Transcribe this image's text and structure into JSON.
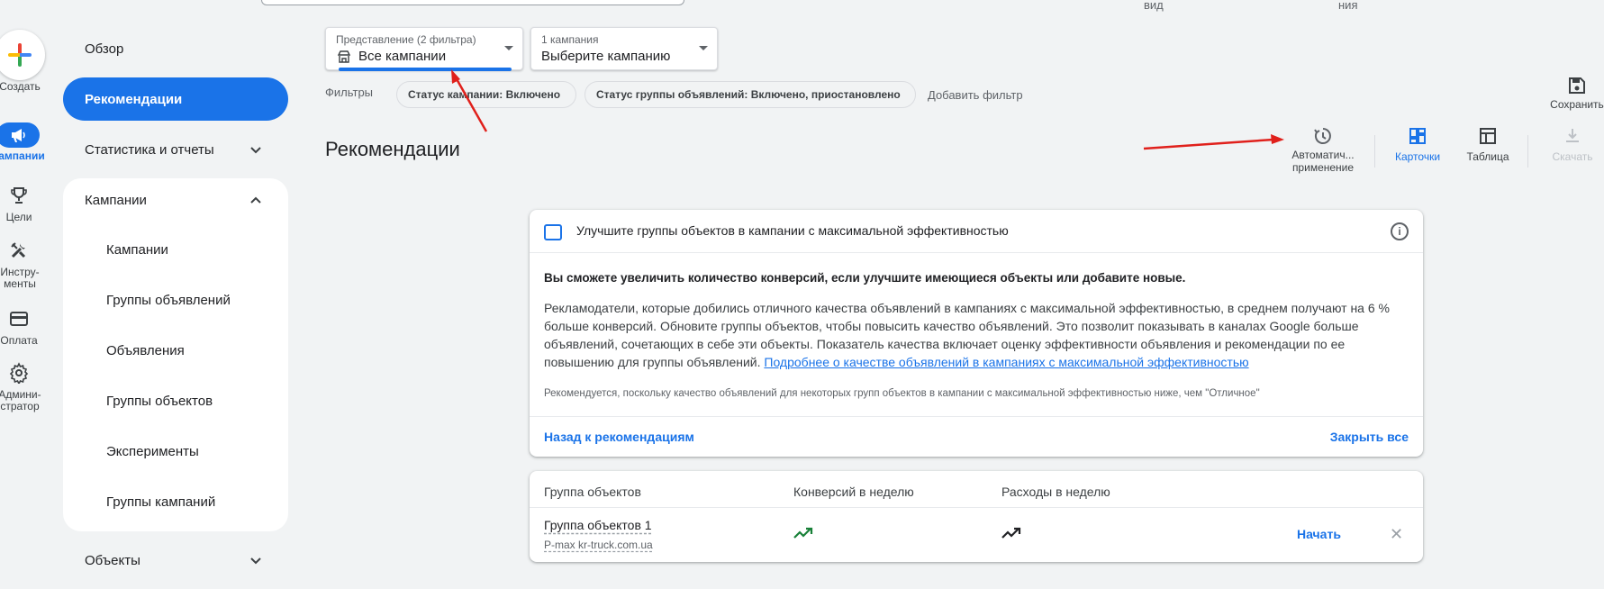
{
  "top": {
    "frag_left": "вид",
    "frag_right": "ния"
  },
  "rail": {
    "create_label": "Создать",
    "campaigns_label": "ампании",
    "goals_label": "Цели",
    "tools_label": "Инстру-\nменты",
    "billing_label": "Оплата",
    "admin_label": "Админи-\nстратор"
  },
  "nav": {
    "overview": "Обзор",
    "recommendations": "Рекомендации",
    "stats": "Статистика и отчеты",
    "campaigns_group": "Кампании",
    "sub_items": [
      "Кампании",
      "Группы объявлений",
      "Объявления",
      "Группы объектов",
      "Эксперименты",
      "Группы кампаний"
    ],
    "objects": "Объекты"
  },
  "view_selector": {
    "caption": "Представление (2 фильтра)",
    "value": "Все кампании"
  },
  "campaign_selector": {
    "caption": "1 кампания",
    "value": "Выберите кампанию"
  },
  "filters": {
    "label": "Фильтры",
    "chips": [
      "Статус кампании: Включено",
      "Статус группы объявлений: Включено, приостановлено"
    ],
    "add": "Добавить фильтр"
  },
  "save_label": "Сохранить",
  "page_title": "Рекомендации",
  "toolbar": {
    "auto_apply": "Автоматич...\nприменение",
    "cards": "Карточки",
    "table": "Таблица",
    "download": "Скачать"
  },
  "card": {
    "title": "Улучшите группы объектов в кампании с максимальной эффективностью",
    "lead": "Вы сможете увеличить количество конверсий, если улучшите имеющиеся объекты или добавите новые.",
    "body": "Рекламодатели, которые добились отличного качества объявлений в кампаниях с максимальной эффективностью, в среднем получают на 6 % больше конверсий. Обновите группы объектов, чтобы повысить качество объявлений. Это позволит показывать в каналах Google больше объявлений, сочетающих в себе эти объекты. Показатель качества включает оценку эффективности объявления и рекомендации по ее повышению для группы объявлений.",
    "link": "Подробнее о качестве объявлений в кампаниях с максимальной эффективностью",
    "note": "Рекомендуется, поскольку качество объявлений для некоторых групп объектов в кампании с максимальной эффективностью ниже, чем \"Отличное\"",
    "back": "Назад к рекомендациям",
    "close_all": "Закрыть все"
  },
  "table": {
    "headers": [
      "Группа объектов",
      "Конверсий в неделю",
      "Расходы в неделю"
    ],
    "row": {
      "name": "Группа объектов 1",
      "campaign": "P-max kr-truck.com.ua",
      "action": "Начать"
    }
  },
  "colors": {
    "accent": "#1a73e8",
    "annotation": "#e0201b",
    "trend_up": "#188038"
  }
}
